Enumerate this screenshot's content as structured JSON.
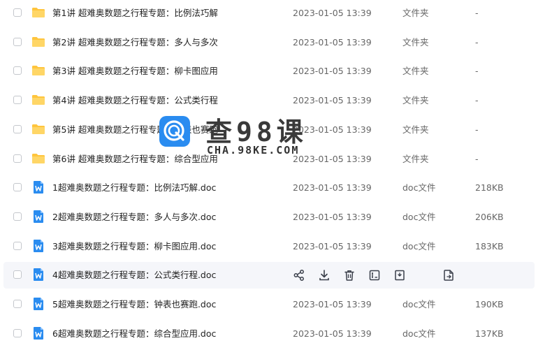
{
  "files": [
    {
      "name": "第1讲 超难奥数题之行程专题：比例法巧解",
      "date": "2023-01-05 13:39",
      "type": "文件夹",
      "size": "-",
      "icon": "folder-icon"
    },
    {
      "name": "第2讲 超难奥数题之行程专题：多人与多次",
      "date": "2023-01-05 13:39",
      "type": "文件夹",
      "size": "-",
      "icon": "folder-icon"
    },
    {
      "name": "第3讲 超难奥数题之行程专题：柳卡图应用",
      "date": "2023-01-05 13:39",
      "type": "文件夹",
      "size": "-",
      "icon": "folder-icon"
    },
    {
      "name": "第4讲 超难奥数题之行程专题：公式类行程",
      "date": "2023-01-05 13:39",
      "type": "文件夹",
      "size": "-",
      "icon": "folder-icon"
    },
    {
      "name": "第5讲 超难奥数题之行程专题：钟表也赛跑",
      "date": "2023-01-05 13:39",
      "type": "文件夹",
      "size": "-",
      "icon": "folder-icon"
    },
    {
      "name": "第6讲 超难奥数题之行程专题：综合型应用",
      "date": "2023-01-05 13:39",
      "type": "文件夹",
      "size": "-",
      "icon": "folder-icon"
    },
    {
      "name": "1超难奥数题之行程专题：比例法巧解.doc",
      "date": "2023-01-05 13:39",
      "type": "doc文件",
      "size": "218KB",
      "icon": "word-doc-icon"
    },
    {
      "name": "2超难奥数题之行程专题：多人与多次.doc",
      "date": "2023-01-05 13:39",
      "type": "doc文件",
      "size": "206KB",
      "icon": "word-doc-icon"
    },
    {
      "name": "3超难奥数题之行程专题：柳卡图应用.doc",
      "date": "2023-01-05 13:39",
      "type": "doc文件",
      "size": "183KB",
      "icon": "word-doc-icon"
    },
    {
      "name": "4超难奥数题之行程专题：公式类行程.doc",
      "date": "",
      "type": "",
      "size": "",
      "icon": "word-doc-icon",
      "hovered": true
    },
    {
      "name": "5超难奥数题之行程专题：钟表也赛跑.doc",
      "date": "2023-01-05 13:39",
      "type": "doc文件",
      "size": "190KB",
      "icon": "word-doc-icon"
    },
    {
      "name": "6超难奥数题之行程专题：综合型应用.doc",
      "date": "2023-01-05 13:39",
      "type": "doc文件",
      "size": "137KB",
      "icon": "word-doc-icon"
    }
  ],
  "row_actions": [
    "share-icon",
    "download-icon",
    "delete-icon",
    "rename-icon",
    "move-icon",
    "copy-icon"
  ],
  "watermark": {
    "title": "查98课",
    "subtitle": "CHA.98KE.COM"
  },
  "colors": {
    "folder": "#ffc53d",
    "word": "#2a8cf0",
    "hover_bg": "#f5f6fa",
    "icon": "#3a3f4a"
  }
}
